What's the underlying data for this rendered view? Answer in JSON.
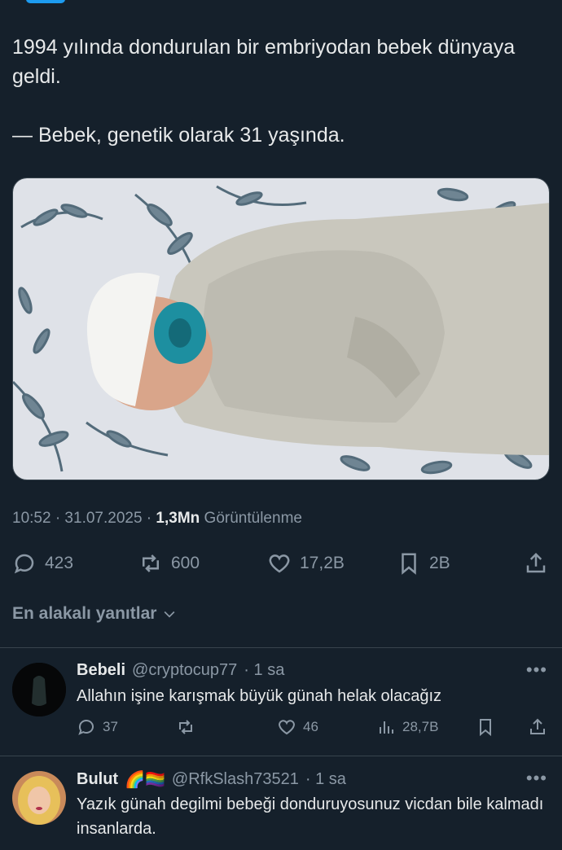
{
  "tweet": {
    "text": "1994 yılında dondurulan bir embriyodan bebek dünyaya geldi.\n\n— Bebek, genetik olarak 31 yaşında.",
    "time": "10:52 · 31.07.2025 · ",
    "views_count": "1,3Mn",
    "views_label": " Görüntülenme"
  },
  "actions": {
    "replies": "423",
    "reposts": "600",
    "likes": "17,2B",
    "bookmarks": "2B"
  },
  "sort": {
    "label": "En alakalı yanıtlar"
  },
  "replies": [
    {
      "name": "Bebeli",
      "handle": "@cryptocup77",
      "time": "· 1 sa",
      "text": "Allahın işine karışmak büyük günah helak olacağız",
      "replies": "37",
      "reposts": "",
      "likes": "46",
      "views": "28,7B"
    },
    {
      "name": "Bulut",
      "badges": "🌈🏳️‍🌈",
      "handle": "@RfkSlash73521",
      "time": "· 1 sa",
      "text": "Yazık günah degilmi bebeği donduruyosunuz vicdan bile kalmadı insanlarda."
    }
  ],
  "colors": {
    "background": "#15202b",
    "text": "#e7e9ea",
    "muted": "#8b98a5",
    "border": "#38444d",
    "accent": "#1d9bf0"
  },
  "icons": [
    "reply-icon",
    "repost-icon",
    "like-icon",
    "bookmark-icon",
    "share-icon",
    "views-icon",
    "more-icon",
    "chevron-down-icon"
  ]
}
